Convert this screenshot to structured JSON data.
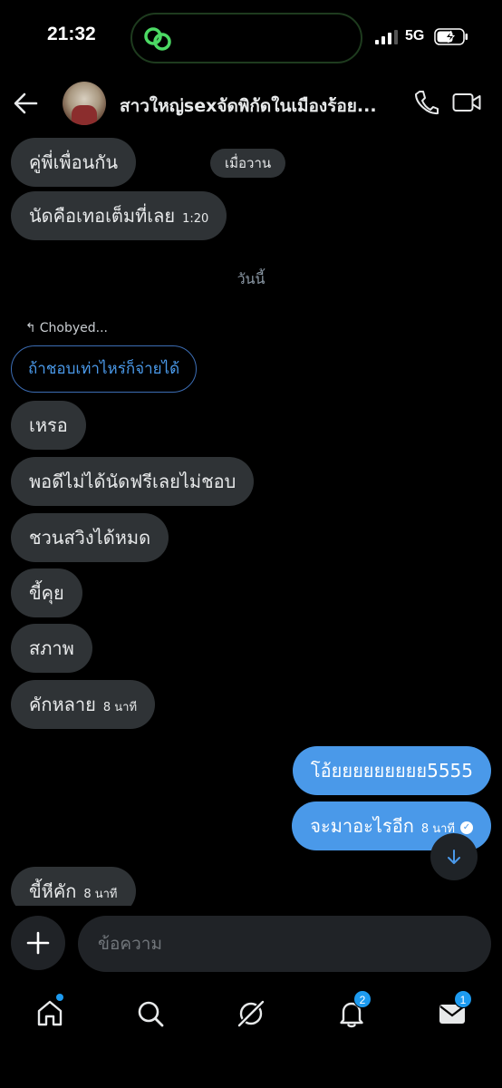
{
  "status": {
    "time": "21:32",
    "network": "5G"
  },
  "header": {
    "contact_name": "สาวใหญ่sexจัดพิกัดในเมืองร้อย..."
  },
  "chat": {
    "messages_top": [
      {
        "text": "คู่พี่เพื่อนกัน",
        "time": ""
      },
      {
        "text": "นัดคือเทอเต็มที่เลย",
        "time": "1:20"
      }
    ],
    "yesterday_chip": "เมื่อวาน",
    "day_separator": "วันนี้",
    "reply_to_name": "Chobyed...",
    "reply_quote": "ถ้าชอบเท่าไหร่ก็จ่ายได้",
    "incoming": [
      {
        "text": "เหรอ",
        "time": ""
      },
      {
        "text": "พอดีไม่ได้นัดฟรีเลยไม่ชอบ",
        "time": ""
      },
      {
        "text": "ชวนสวิงได้หมด",
        "time": ""
      },
      {
        "text": "ขี้คุย",
        "time": ""
      },
      {
        "text": "สภาพ",
        "time": ""
      },
      {
        "text": "คักหลาย",
        "time": "8 นาที"
      }
    ],
    "outgoing": [
      {
        "text": "โอ้ยยยยยยยยย5555",
        "time": ""
      },
      {
        "text": "จะมาอะไรอีก",
        "time": "8 นาที"
      }
    ],
    "last_incoming": {
      "text": "ขี้หีคัก",
      "time": "8 นาที"
    }
  },
  "composer": {
    "placeholder": "ข้อความ"
  },
  "nav": {
    "notifications_badge": "2",
    "messages_badge": "1"
  },
  "colors": {
    "accent": "#1d9bf0",
    "outgoing_bubble": "#4a99e9",
    "incoming_bubble": "#2f3336"
  }
}
